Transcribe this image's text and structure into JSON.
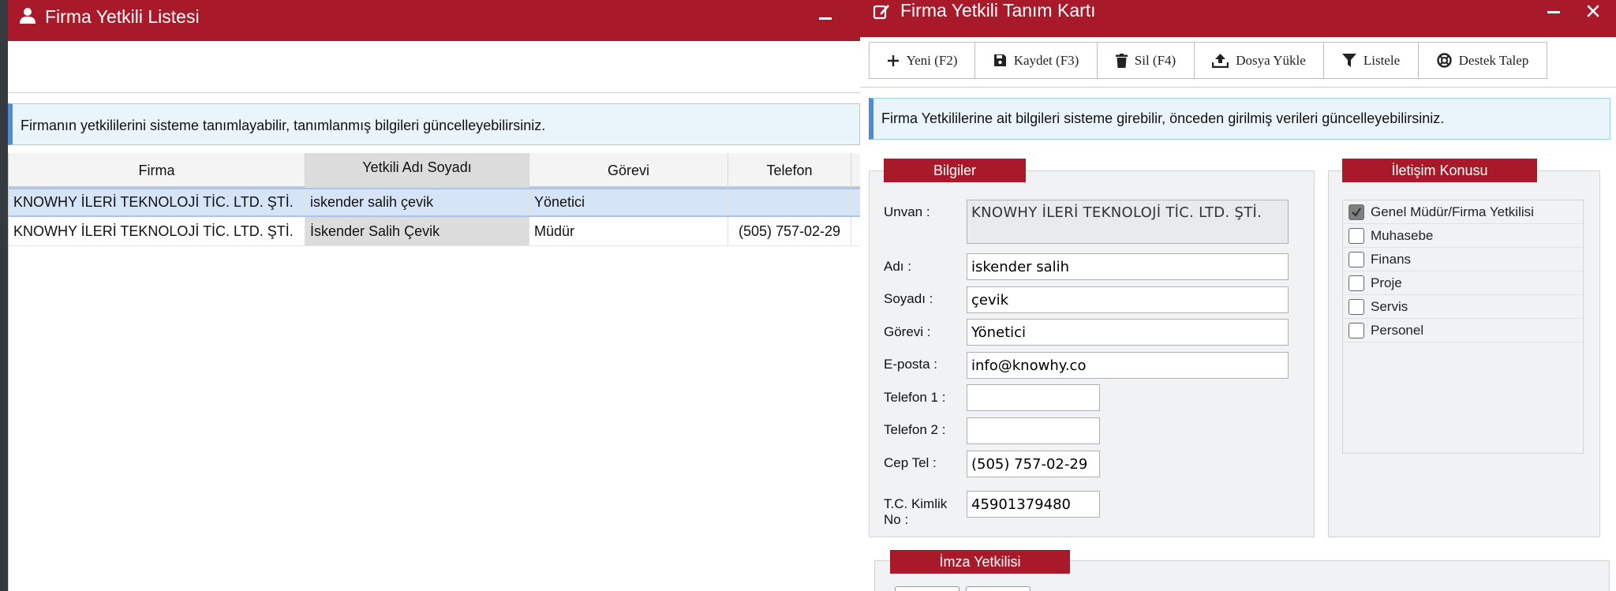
{
  "left_window": {
    "title": "Firma Yetkili Listesi",
    "info_text": "Firmanın yetkililerini sisteme tanımlayabilir, tanımlanmış bilgileri güncelleyebilirsiniz.",
    "columns": [
      "Firma",
      "Yetkili Adı Soyadı",
      "Görevi",
      "Telefon"
    ],
    "rows": [
      {
        "firma": "KNOWHY İLERİ TEKNOLOJİ TİC. LTD. ŞTİ.",
        "name": "iskender salih çevik",
        "gorev": "Yönetici",
        "telefon": ""
      },
      {
        "firma": "KNOWHY İLERİ TEKNOLOJİ TİC. LTD. ŞTİ.",
        "name": "İskender Salih Çevik",
        "gorev": "Müdür",
        "telefon": "(505) 757-02-29"
      }
    ]
  },
  "right_window": {
    "title": "Firma Yetkili Tanım Kartı",
    "toolbar": {
      "new": "Yeni (F2)",
      "save": "Kaydet (F3)",
      "delete": "Sil (F4)",
      "upload": "Dosya Yükle",
      "list": "Listele",
      "support": "Destek Talep"
    },
    "info_text": "Firma Yetkililerine ait bilgileri sisteme girebilir, önceden girilmiş verileri güncelleyebilirsiniz.",
    "bilgiler": {
      "legend": "Bilgiler",
      "unvan_label": "Unvan :",
      "unvan_value": "KNOWHY İLERİ TEKNOLOJİ TİC. LTD. ŞTİ.",
      "adi_label": "Adı :",
      "adi_value": "iskender salih",
      "soyadi_label": "Soyadı :",
      "soyadi_value": "çevik",
      "gorevi_label": "Görevi :",
      "gorevi_value": "Yönetici",
      "eposta_label": "E-posta :",
      "eposta_value": "info@knowhy.co",
      "tel1_label": "Telefon 1 :",
      "tel1_value": "",
      "tel2_label": "Telefon 2 :",
      "tel2_value": "",
      "cep_label": "Cep Tel :",
      "cep_value": "(505) 757-02-29",
      "tc_label_1": "T.C. Kimlik",
      "tc_label_2": "No :",
      "tc_value": "45901379480"
    },
    "iletisim": {
      "legend": "İletişim Konusu",
      "items": [
        {
          "label": "Genel Müdür/Firma Yetkilisi",
          "checked": true
        },
        {
          "label": "Muhasebe",
          "checked": false
        },
        {
          "label": "Finans",
          "checked": false
        },
        {
          "label": "Proje",
          "checked": false
        },
        {
          "label": "Servis",
          "checked": false
        },
        {
          "label": "Personel",
          "checked": false
        }
      ]
    },
    "imza": {
      "legend": "İmza Yetkilisi"
    }
  },
  "colors": {
    "titlebar": "#a81a2a",
    "info_bg": "#eaf5fb",
    "info_border": "#4e8cd3",
    "selected_row": "#d6e4f7"
  }
}
